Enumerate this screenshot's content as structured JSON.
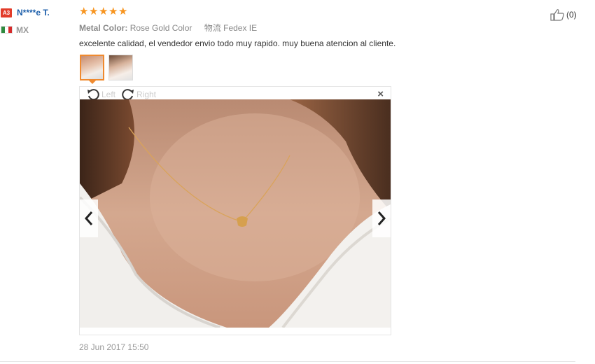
{
  "reviewer": {
    "badge": "A3",
    "name": "N****e T.",
    "country": "MX",
    "flag_colors": [
      "#2e8b3e",
      "#ffffff",
      "#d62a2a"
    ]
  },
  "rating": {
    "stars": 5,
    "max": 5,
    "color": "#f79520"
  },
  "attributes": {
    "metal_color_label": "Metal Color:",
    "metal_color_value": "Rose Gold Color",
    "shipping_label": "物流",
    "shipping_value": "Fedex IE"
  },
  "review_text": "excelente calidad, el vendedor envio todo muy rapido. muy buena atencion al cliente.",
  "thumbnails": {
    "count": 2,
    "selected_index": 0,
    "accent": "#ef8a2f"
  },
  "viewer": {
    "rotate_left_label": "Left",
    "rotate_right_label": "Right",
    "close_symbol": "×",
    "prev_icon": "chevron-left-icon",
    "next_icon": "chevron-right-icon"
  },
  "date": "28 Jun 2017 15:50",
  "helpful": {
    "icon": "thumbs-up-icon",
    "count_text": "(0)"
  }
}
